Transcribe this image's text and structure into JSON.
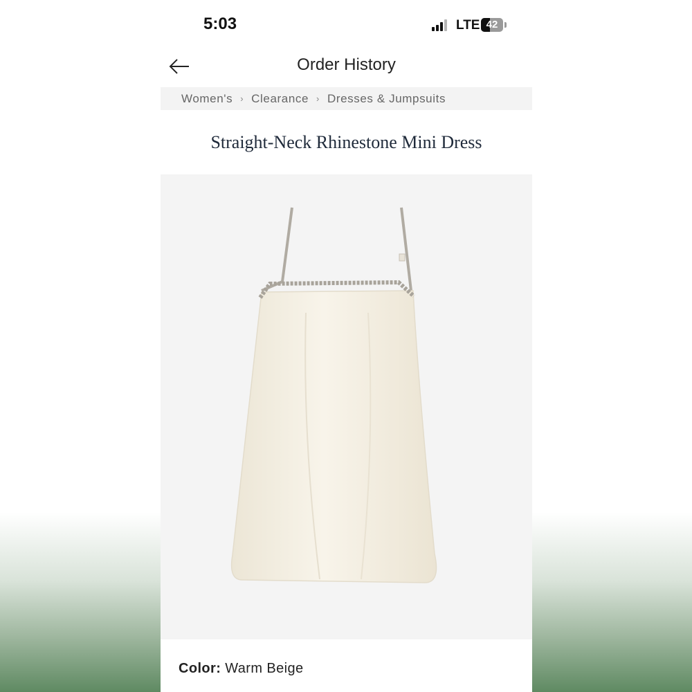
{
  "status_bar": {
    "time": "5:03",
    "network": "LTE",
    "battery": "42",
    "battery_level": 0.42
  },
  "header": {
    "title": "Order History",
    "back_icon": "arrow-left-icon"
  },
  "breadcrumbs": [
    "Women's",
    "Clearance",
    "Dresses & Jumpsuits"
  ],
  "breadcrumb_separator_icon": "chevron-right-icon",
  "product": {
    "title": "Straight-Neck Rhinestone Mini Dress",
    "color_label": "Color:",
    "color_value": "Warm Beige",
    "image": "cream-satin-mini-dress-with-rhinestone-straps"
  },
  "colors": {
    "dress": "#f4efe3",
    "rhinestone_trim": "#a8a39a",
    "title_text": "#1f2a3a"
  }
}
